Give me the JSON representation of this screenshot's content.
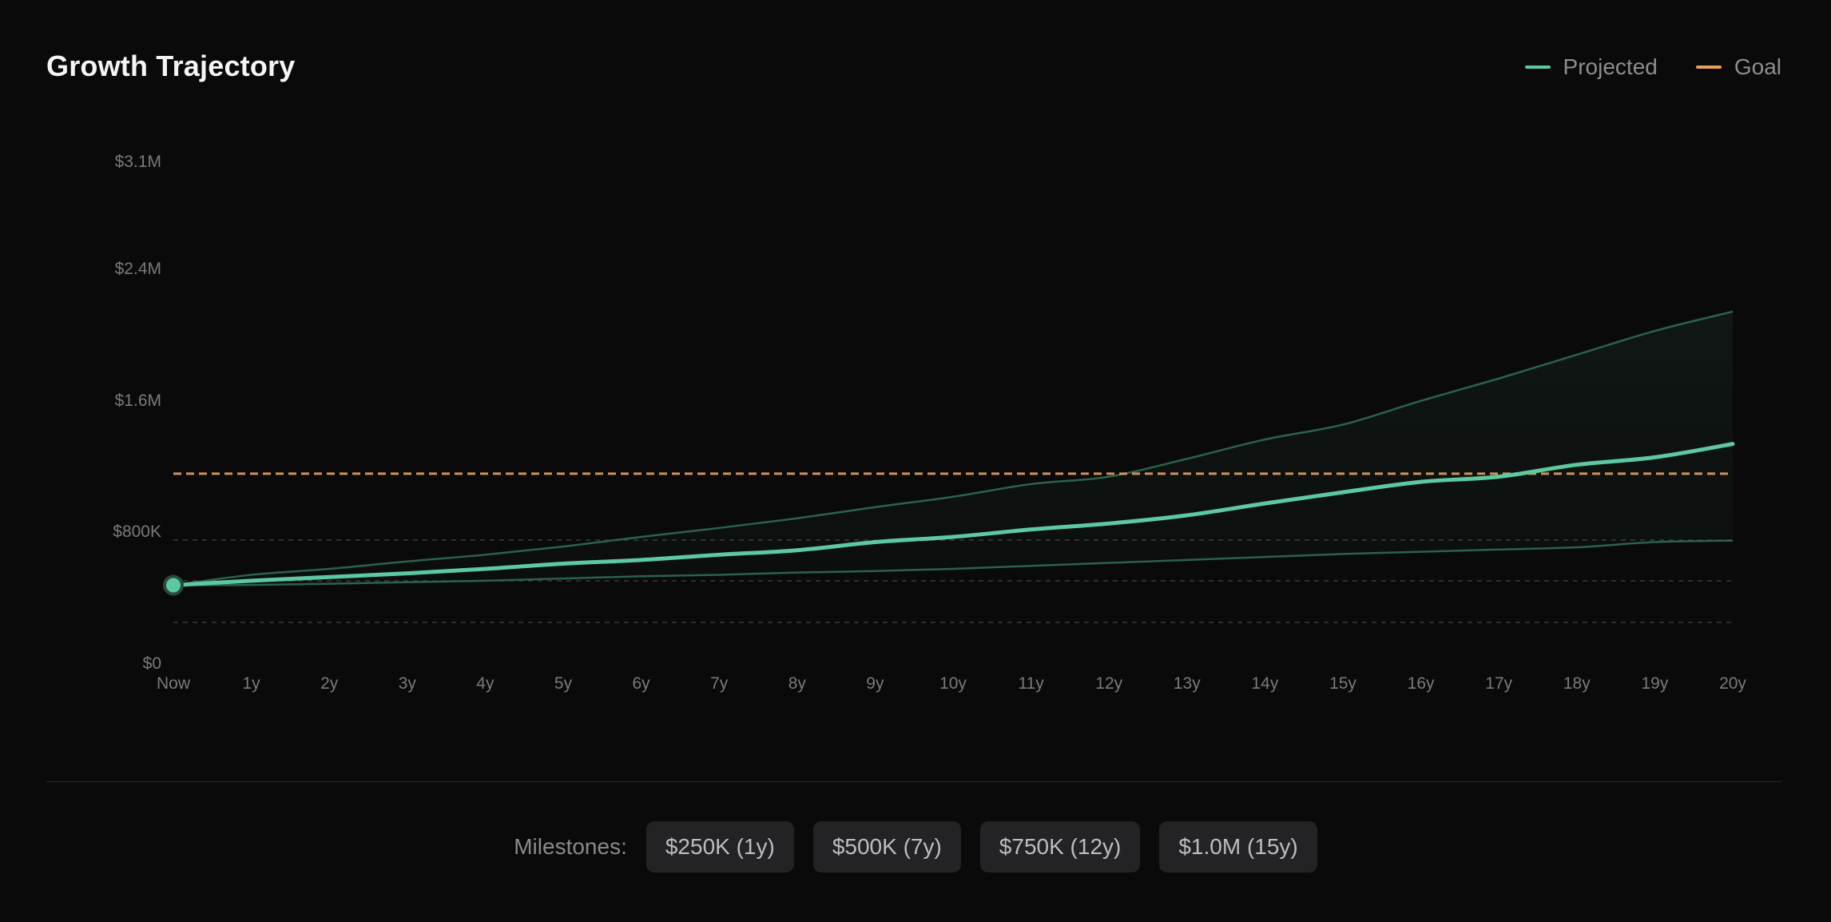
{
  "header": {
    "title": "Growth Trajectory"
  },
  "legend": [
    {
      "label": "Projected",
      "color": "#5cc9a0"
    },
    {
      "label": "Goal",
      "color": "#e8a15c"
    }
  ],
  "milestones": {
    "label": "Milestones:",
    "items": [
      "$250K (1y)",
      "$500K (7y)",
      "$750K (12y)",
      "$1.0M (15y)"
    ]
  },
  "chart_data": {
    "type": "line",
    "title": "Growth Trajectory",
    "x": [
      "Now",
      "1y",
      "2y",
      "3y",
      "4y",
      "5y",
      "6y",
      "7y",
      "8y",
      "9y",
      "10y",
      "11y",
      "12y",
      "13y",
      "14y",
      "15y",
      "16y",
      "17y",
      "18y",
      "19y",
      "20y"
    ],
    "y_tick_labels": [
      "$0",
      "$800K",
      "$1.6M",
      "$2.4M",
      "$3.1M"
    ],
    "ylim": [
      0,
      3100000
    ],
    "grid": true,
    "legend_position": "top-right",
    "goal": 1000000,
    "series": [
      {
        "name": "Projected",
        "color": "#5cc9a0",
        "values": [
          250000,
          280000,
          305000,
          330000,
          360000,
          395000,
          420000,
          455000,
          485000,
          540000,
          575000,
          625000,
          665000,
          720000,
          800000,
          875000,
          945000,
          980000,
          1060000,
          1110000,
          1200000
        ]
      },
      {
        "color": "#2f6b54",
        "values": [
          250000,
          320000,
          360000,
          410000,
          455000,
          510000,
          575000,
          635000,
          700000,
          775000,
          845000,
          930000,
          980000,
          1100000,
          1230000,
          1330000,
          1490000,
          1640000,
          1800000,
          1960000,
          2090000
        ]
      },
      {
        "color": "#2f6b54",
        "values": [
          250000,
          252000,
          260000,
          270000,
          280000,
          295000,
          310000,
          320000,
          335000,
          345000,
          360000,
          380000,
          400000,
          420000,
          440000,
          460000,
          475000,
          490000,
          505000,
          540000,
          550000
        ]
      }
    ]
  }
}
